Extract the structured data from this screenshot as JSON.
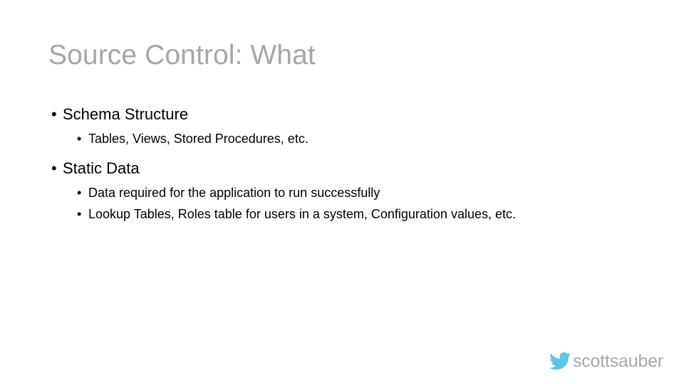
{
  "slide": {
    "title": "Source Control: What",
    "title_color": "#a6a6a6",
    "background_color": "#ffffff",
    "body_color": "#000000",
    "bullet_glyph": "•",
    "groups": [
      {
        "level1": "Schema Structure",
        "level2": [
          "Tables, Views, Stored Procedures, etc."
        ]
      },
      {
        "level1": "Static Data",
        "level2": [
          "Data required for the application to run successfully",
          "Lookup Tables, Roles table for users in a system, Configuration values, etc."
        ]
      }
    ]
  },
  "handle": {
    "icon": "twitter-bird-icon",
    "icon_color": "#5ec5e8",
    "text": "scottsauber",
    "text_color": "#a8a8a8"
  }
}
